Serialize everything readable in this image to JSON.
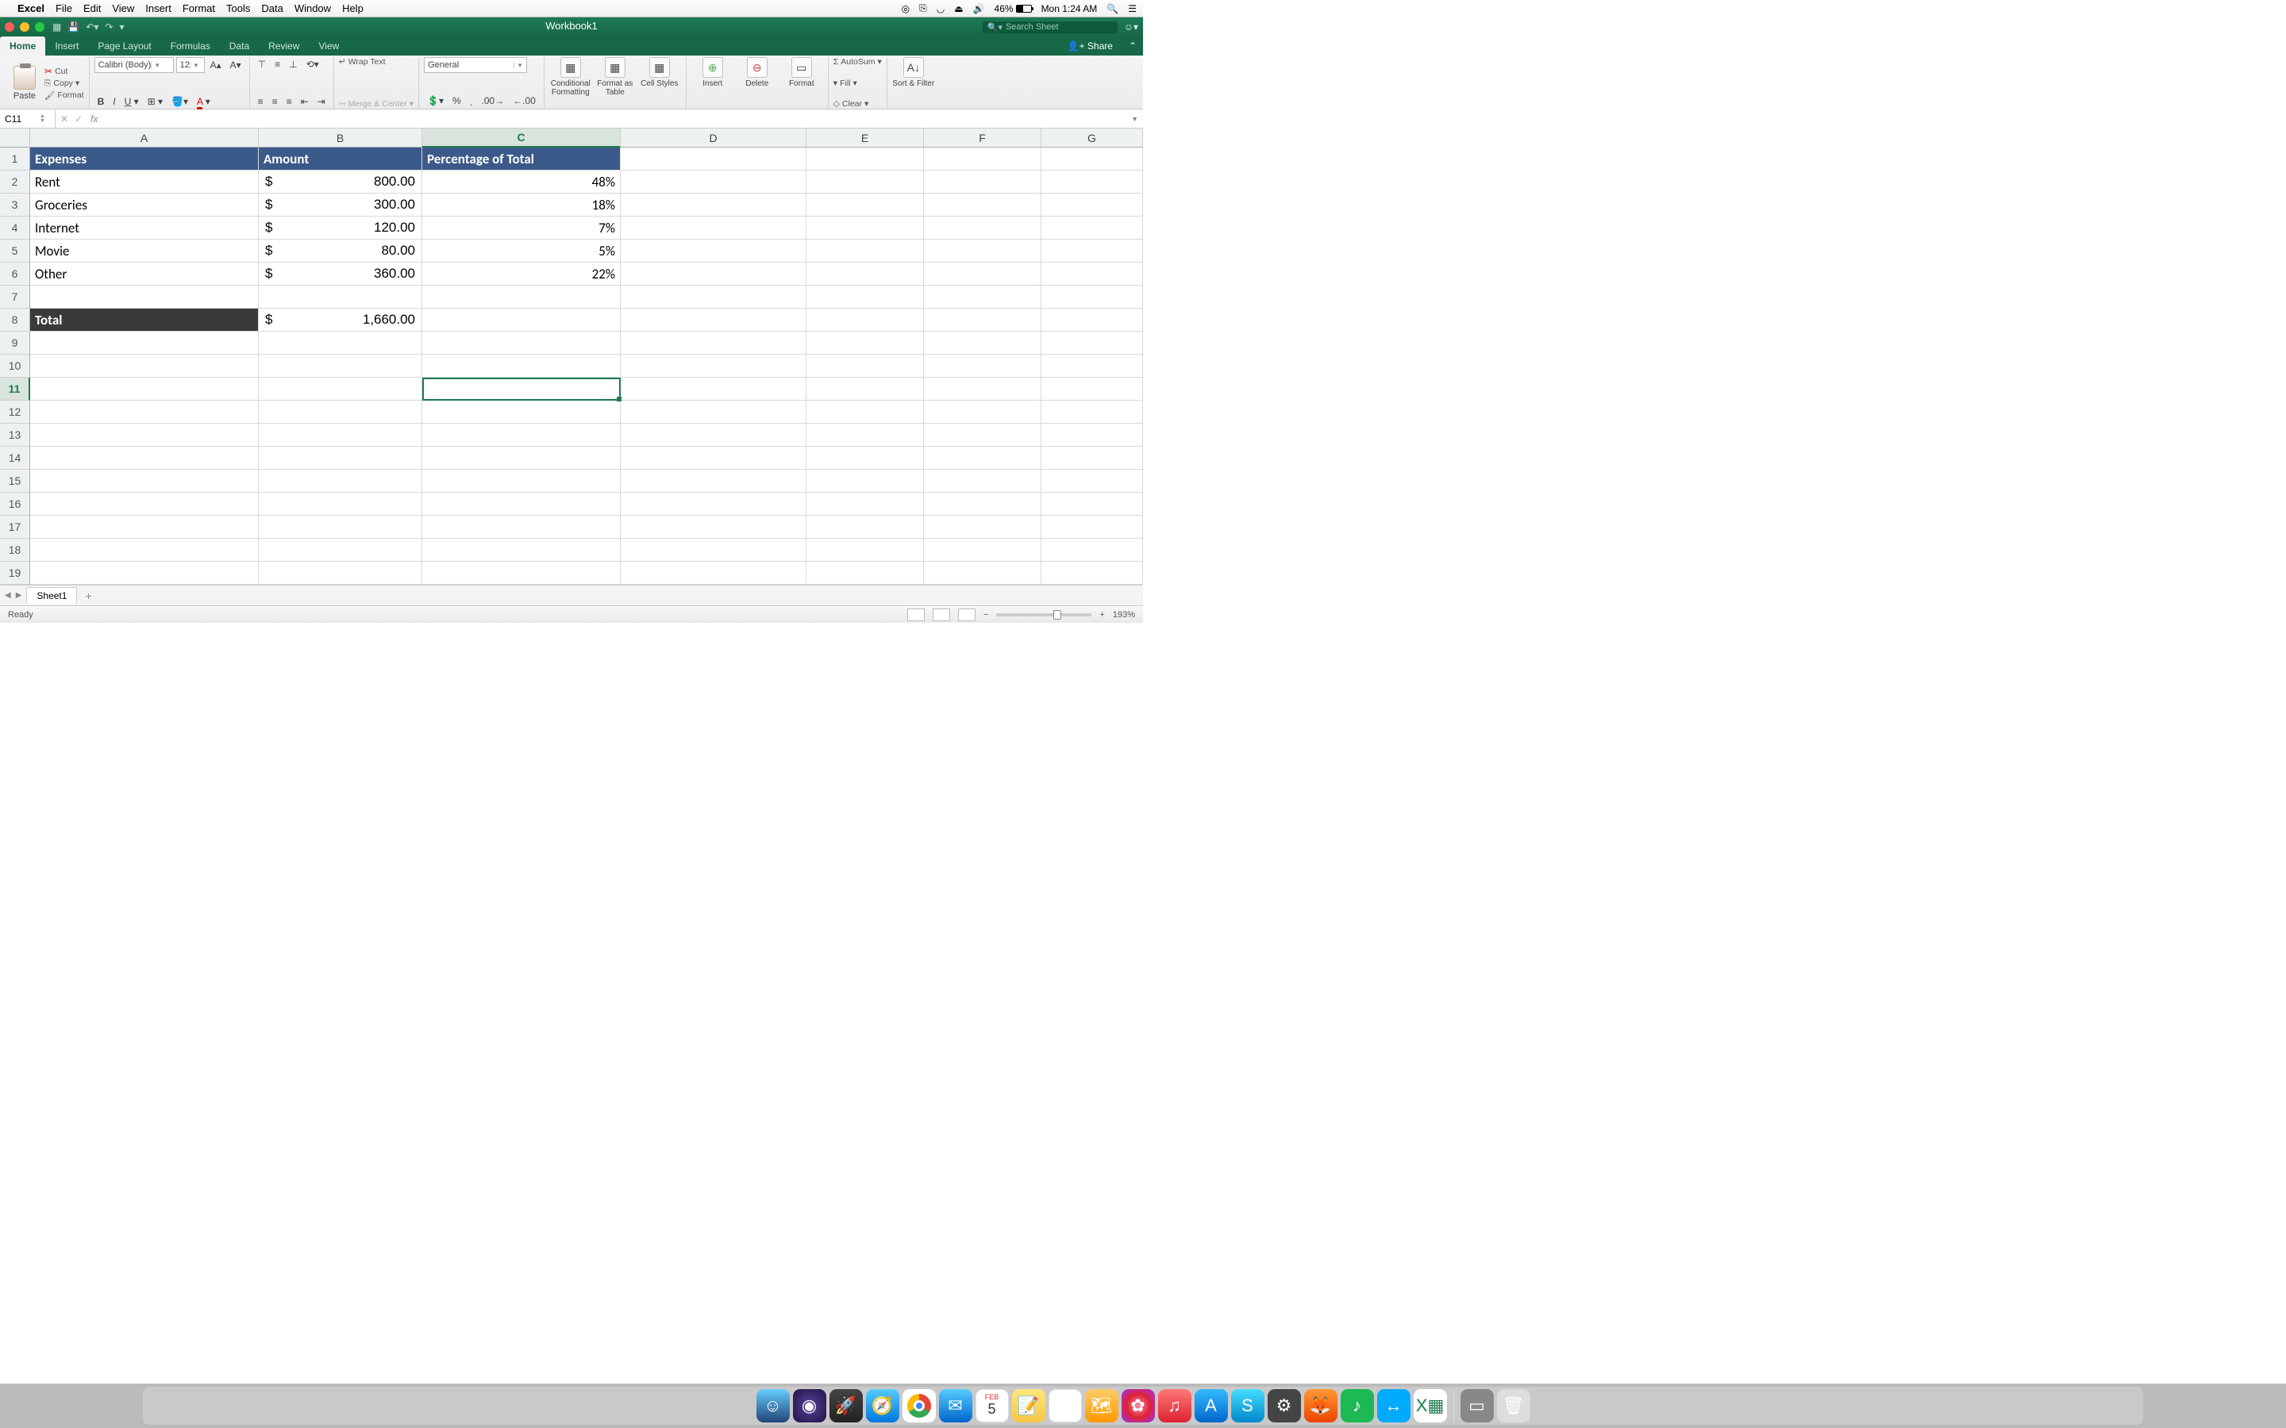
{
  "menubar": {
    "app": "Excel",
    "items": [
      "File",
      "Edit",
      "View",
      "Insert",
      "Format",
      "Tools",
      "Data",
      "Window",
      "Help"
    ],
    "battery": "46%",
    "clock": "Mon 1:24 AM"
  },
  "titlebar": {
    "workbook": "Workbook1",
    "search_placeholder": "Search Sheet"
  },
  "tabs": [
    "Home",
    "Insert",
    "Page Layout",
    "Formulas",
    "Data",
    "Review",
    "View"
  ],
  "share": "Share",
  "ribbon": {
    "paste": "Paste",
    "cut": "Cut",
    "copy": "Copy",
    "format_p": "Format",
    "font": "Calibri (Body)",
    "size": "12",
    "wrap": "Wrap Text",
    "merge": "Merge & Center",
    "numfmt": "General",
    "cond": "Conditional Formatting",
    "fat": "Format as Table",
    "styles": "Cell Styles",
    "insert": "Insert",
    "delete": "Delete",
    "format": "Format",
    "autosum": "AutoSum",
    "fill": "Fill",
    "clear": "Clear",
    "sortfilter": "Sort & Filter"
  },
  "namebox": "C11",
  "columns": [
    "A",
    "B",
    "C",
    "D",
    "E",
    "F",
    "G"
  ],
  "rows": [
    "1",
    "2",
    "3",
    "4",
    "5",
    "6",
    "7",
    "8",
    "9",
    "10",
    "11",
    "12",
    "13",
    "14",
    "15",
    "16",
    "17",
    "18",
    "19"
  ],
  "headers": {
    "a": "Expenses",
    "b": "Amount",
    "c": "Percentage of Total"
  },
  "data": [
    {
      "name": "Rent",
      "amt": "800.00",
      "pct": "48%"
    },
    {
      "name": "Groceries",
      "amt": "300.00",
      "pct": "18%"
    },
    {
      "name": "Internet",
      "amt": "120.00",
      "pct": "7%"
    },
    {
      "name": "Movie",
      "amt": "80.00",
      "pct": "5%"
    },
    {
      "name": "Other",
      "amt": "360.00",
      "pct": "22%"
    }
  ],
  "total": {
    "label": "Total",
    "amt": "1,660.00"
  },
  "currency": "$",
  "sheet_tab": "Sheet1",
  "status": "Ready",
  "zoom": "193%",
  "colors": {
    "excel_green": "#176846",
    "header_blue": "#3b5a8a",
    "selection": "#1e7a4e"
  }
}
